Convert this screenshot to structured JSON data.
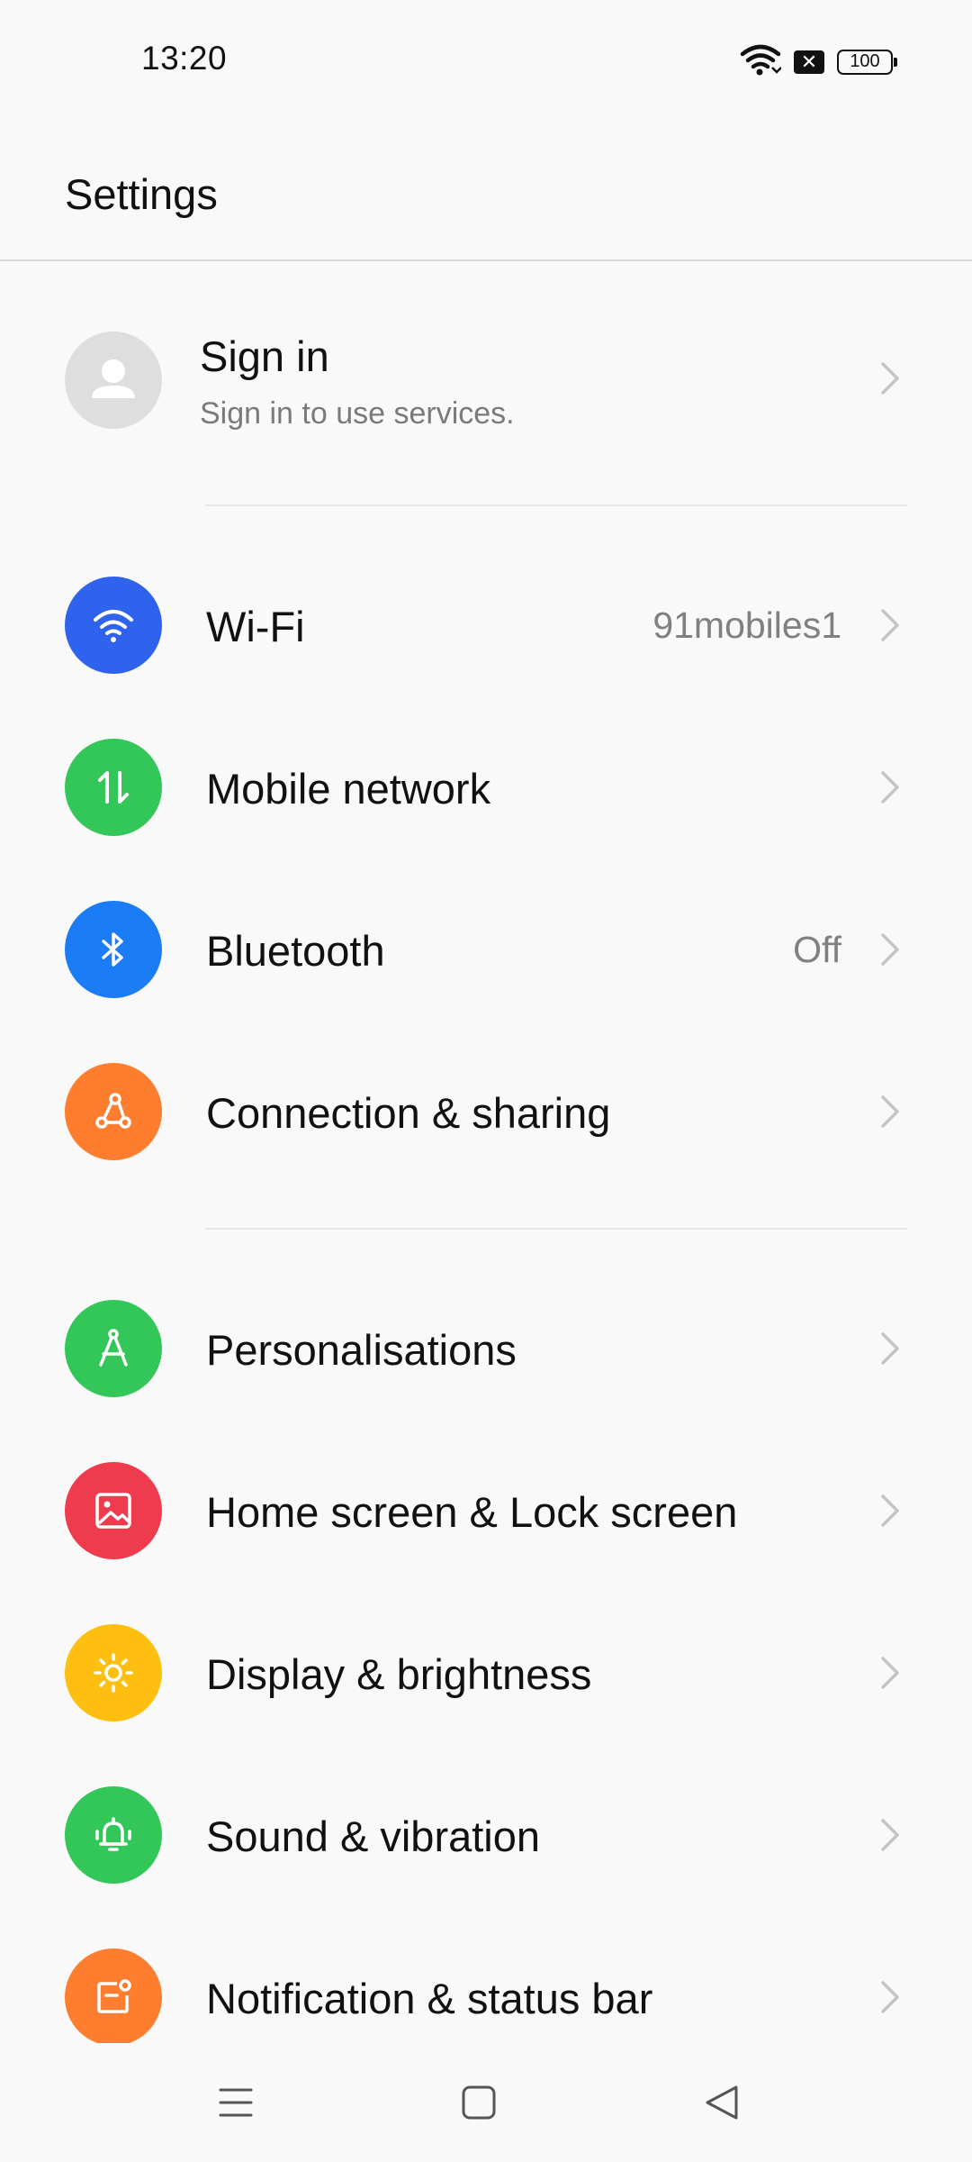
{
  "status_bar": {
    "time": "13:20",
    "battery": "100",
    "wifi_icon": "wifi-signal-icon",
    "sim_icon": "no-sim-icon"
  },
  "header": {
    "title": "Settings"
  },
  "account": {
    "title": "Sign in",
    "subtitle": "Sign in to use services.",
    "icon": "person-avatar-icon"
  },
  "groups": [
    {
      "items": [
        {
          "label": "Wi-Fi",
          "value": "91mobiles1",
          "icon": "wifi-icon",
          "color": "#2f63ee"
        },
        {
          "label": "Mobile network",
          "value": "",
          "icon": "mobile-data-icon",
          "color": "#33c659"
        },
        {
          "label": "Bluetooth",
          "value": "Off",
          "icon": "bluetooth-icon",
          "color": "#1b7cf5"
        },
        {
          "label": "Connection & sharing",
          "value": "",
          "icon": "connection-sharing-icon",
          "color": "#ff7d2e"
        }
      ]
    },
    {
      "items": [
        {
          "label": "Personalisations",
          "value": "",
          "icon": "compass-icon",
          "color": "#33c659"
        },
        {
          "label": "Home screen & Lock screen",
          "value": "",
          "icon": "image-icon",
          "color": "#ee3b4e"
        },
        {
          "label": "Display & brightness",
          "value": "",
          "icon": "sun-icon",
          "color": "#ffbf10"
        },
        {
          "label": "Sound & vibration",
          "value": "",
          "icon": "bell-icon",
          "color": "#33c659"
        },
        {
          "label": "Notification & status bar",
          "value": "",
          "icon": "notification-icon",
          "color": "#ff7d2e"
        }
      ]
    }
  ],
  "nav_bar": {
    "menu_icon": "menu-icon",
    "home_icon": "home-square-icon",
    "back_icon": "back-triangle-icon"
  }
}
